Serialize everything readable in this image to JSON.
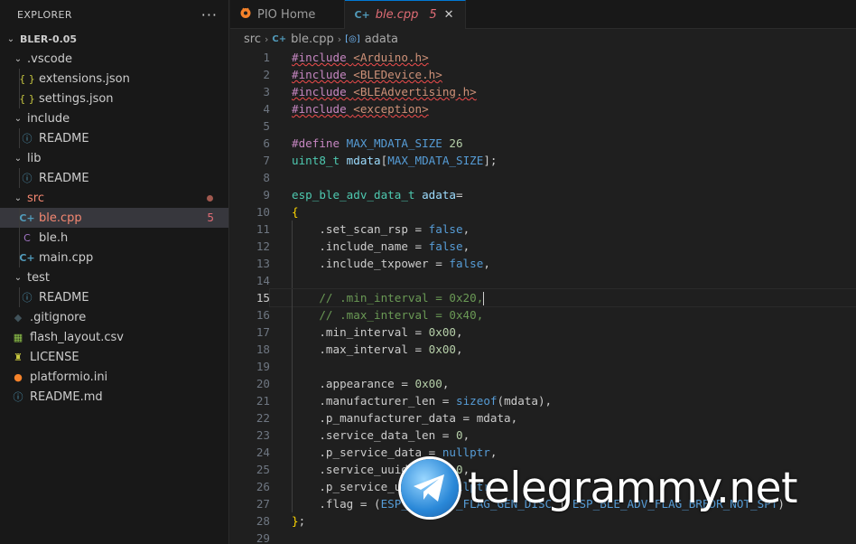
{
  "explorer": {
    "title": "EXPLORER",
    "more": "···",
    "items": [
      {
        "label": "BLER-0.05",
        "kind": "root",
        "depth": 0,
        "chev": "⌄"
      },
      {
        "label": ".vscode",
        "kind": "folder",
        "depth": 1,
        "chev": "⌄"
      },
      {
        "label": "extensions.json",
        "kind": "json",
        "depth": 2
      },
      {
        "label": "settings.json",
        "kind": "json",
        "depth": 2
      },
      {
        "label": "include",
        "kind": "folder",
        "depth": 1,
        "chev": "⌄"
      },
      {
        "label": "README",
        "kind": "info",
        "depth": 2
      },
      {
        "label": "lib",
        "kind": "folder",
        "depth": 1,
        "chev": "⌄"
      },
      {
        "label": "README",
        "kind": "info",
        "depth": 2
      },
      {
        "label": "src",
        "kind": "folder",
        "depth": 1,
        "chev": "⌄",
        "modified": true
      },
      {
        "label": "ble.cpp",
        "kind": "cpp",
        "depth": 2,
        "badge": "5",
        "selected": true
      },
      {
        "label": "ble.h",
        "kind": "h",
        "depth": 2
      },
      {
        "label": "main.cpp",
        "kind": "cpp",
        "depth": 2
      },
      {
        "label": "test",
        "kind": "folder",
        "depth": 1,
        "chev": "⌄"
      },
      {
        "label": "README",
        "kind": "info",
        "depth": 2
      },
      {
        "label": ".gitignore",
        "kind": "git",
        "depth": 1
      },
      {
        "label": "flash_layout.csv",
        "kind": "csv",
        "depth": 1
      },
      {
        "label": "LICENSE",
        "kind": "license",
        "depth": 1
      },
      {
        "label": "platformio.ini",
        "kind": "pio",
        "depth": 1
      },
      {
        "label": "README.md",
        "kind": "info",
        "depth": 1
      }
    ]
  },
  "tabs": [
    {
      "label": "PIO Home",
      "active": false
    },
    {
      "label": "ble.cpp",
      "active": true,
      "badge": "5",
      "close": "✕"
    }
  ],
  "breadcrumbs": {
    "folder": "src",
    "file": "ble.cpp",
    "symbol": "adata"
  },
  "code": {
    "current_line": 15,
    "lines": [
      [
        [
          "#include ",
          "kw-pp sq"
        ],
        [
          "<Arduino.h>",
          "str sq"
        ]
      ],
      [
        [
          "#include ",
          "kw-pp sq"
        ],
        [
          "<BLEDevice.h>",
          "str sq"
        ]
      ],
      [
        [
          "#include ",
          "kw-pp sq"
        ],
        [
          "<BLEAdvertising.h>",
          "str sq"
        ]
      ],
      [
        [
          "#include ",
          "kw-pp sq"
        ],
        [
          "<exception>",
          "str sq"
        ]
      ],
      [],
      [
        [
          "#define ",
          "kw-pp"
        ],
        [
          "MAX_MDATA_SIZE",
          "macro"
        ],
        [
          " ",
          ""
        ],
        [
          "26",
          "num"
        ]
      ],
      [
        [
          "uint8_t",
          "type"
        ],
        [
          " ",
          ""
        ],
        [
          "mdata",
          "var"
        ],
        [
          "[",
          ""
        ],
        [
          "MAX_MDATA_SIZE",
          "macro"
        ],
        [
          "];",
          ""
        ]
      ],
      [],
      [
        [
          "esp_ble_adv_data_t",
          "type"
        ],
        [
          " ",
          ""
        ],
        [
          "adata",
          "var"
        ],
        [
          "=",
          ""
        ]
      ],
      [
        [
          "{",
          "brace"
        ]
      ],
      [
        [
          "    .set_scan_rsp = ",
          ""
        ],
        [
          "false",
          "kw"
        ],
        [
          ",",
          ""
        ]
      ],
      [
        [
          "    .include_name = ",
          ""
        ],
        [
          "false",
          "kw"
        ],
        [
          ",",
          ""
        ]
      ],
      [
        [
          "    .include_txpower = ",
          ""
        ],
        [
          "false",
          "kw"
        ],
        [
          ",",
          ""
        ]
      ],
      [],
      [
        [
          "    // .min_interval = 0x20,",
          "cmt"
        ]
      ],
      [
        [
          "    // .max_interval = 0x40,",
          "cmt"
        ]
      ],
      [
        [
          "    .min_interval = ",
          ""
        ],
        [
          "0x00",
          "num"
        ],
        [
          ",",
          ""
        ]
      ],
      [
        [
          "    .max_interval = ",
          ""
        ],
        [
          "0x00",
          "num"
        ],
        [
          ",",
          ""
        ]
      ],
      [],
      [
        [
          "    .appearance = ",
          ""
        ],
        [
          "0x00",
          "num"
        ],
        [
          ",",
          ""
        ]
      ],
      [
        [
          "    .manufacturer_len = ",
          ""
        ],
        [
          "sizeof",
          "kw"
        ],
        [
          "(mdata),",
          ""
        ]
      ],
      [
        [
          "    .p_manufacturer_data = mdata,",
          ""
        ]
      ],
      [
        [
          "    .service_data_len = ",
          ""
        ],
        [
          "0",
          "num"
        ],
        [
          ",",
          ""
        ]
      ],
      [
        [
          "    .p_service_data = ",
          ""
        ],
        [
          "nullptr",
          "kw"
        ],
        [
          ",",
          ""
        ]
      ],
      [
        [
          "    .service_uuid",
          ""
        ],
        [
          "_len = ",
          ""
        ],
        [
          "0",
          "num"
        ],
        [
          ",",
          ""
        ]
      ],
      [
        [
          "    .p_service_u",
          ""
        ],
        [
          "uid = ",
          ""
        ],
        [
          "nullptr",
          "kw"
        ],
        [
          ",",
          ""
        ]
      ],
      [
        [
          "    .flag = (",
          ""
        ],
        [
          "ESP_BLE_ADV_FLAG_GEN_DISC",
          "macro"
        ],
        [
          " | ",
          ""
        ],
        [
          "ESP_BLE_ADV_FLAG_BREDR_NOT_SPT",
          "macro"
        ],
        [
          ")",
          ""
        ]
      ],
      [
        [
          "}",
          "brace"
        ],
        [
          ";",
          ""
        ]
      ],
      []
    ]
  },
  "watermark": {
    "text": "telegrammy.net"
  }
}
